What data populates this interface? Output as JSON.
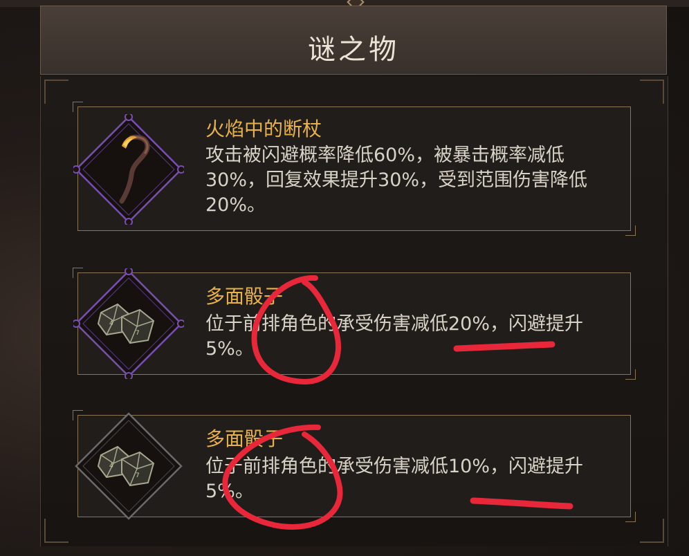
{
  "header": {
    "title": "谜之物"
  },
  "items": [
    {
      "name": "火焰中的断杖",
      "description": "攻击被闪避概率降低60%，被暴击概率减低30%，回复效果提升30%，受到范围伤害降低20%。",
      "icon": "broken-staff-icon",
      "rarity_color": "#7a4fb0"
    },
    {
      "name": "多面骰子",
      "description": "位于前排角色的承受伤害减低20%，闪避提升5%。",
      "icon": "polyhedral-dice-icon",
      "rarity_color": "#7a4fb0"
    },
    {
      "name": "多面骰子",
      "description": "位于前排角色的承受伤害减低10%，闪避提升5%。",
      "icon": "polyhedral-dice-icon",
      "rarity_color": "#6a6a6a"
    }
  ],
  "colors": {
    "item_name": "#e8b24a",
    "description": "#d9d2c6",
    "annotation": "#e8283a"
  }
}
